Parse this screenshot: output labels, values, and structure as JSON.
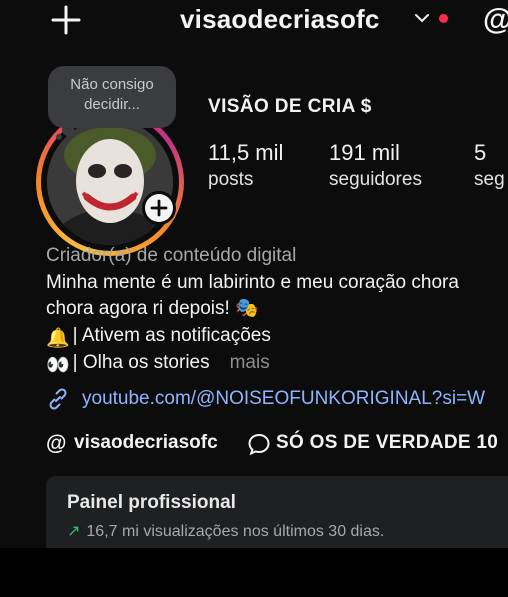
{
  "header": {
    "username": "visaodecriasofc",
    "add_icon": "plus-icon",
    "dropdown_icon": "chevron-down-icon",
    "threads_icon": "@"
  },
  "note": {
    "text_line1": "Não consigo",
    "text_line2": "decidir..."
  },
  "profile": {
    "display_name": "VISÃO DE CRIA $",
    "stats": [
      {
        "value": "11,5 mil",
        "label": "posts"
      },
      {
        "value": "191 mil",
        "label": "seguidores"
      },
      {
        "value": "5",
        "label": "seg"
      }
    ]
  },
  "bio": {
    "category": "Criador(a) de conteúdo digital",
    "line1": "Minha mente é um labirinto e meu coração chora",
    "line2": "chora agora ri depois! 🎭",
    "line3_icon": "🔔",
    "line3": "| Ativem as notificações",
    "line4_icon": "👀",
    "line4": "| Olha os stories",
    "more": "mais",
    "link": "youtube.com/@NOISEOFUNKORIGINAL?si=W",
    "threads_badge": "@",
    "threads_handle": "visaodecriasofc",
    "channel": "SÓ OS DE VERDADE 10"
  },
  "panel": {
    "title": "Painel profissional",
    "trend_icon": "↗",
    "subtitle": "16,7 mi visualizações nos últimos 30 dias."
  },
  "colors": {
    "accent_link": "#8fb4ff",
    "notification_dot": "#ff2b4f",
    "trend": "#24c46b"
  }
}
